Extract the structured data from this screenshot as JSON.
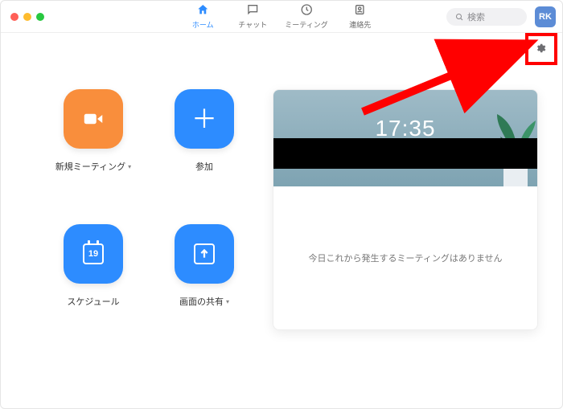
{
  "header": {
    "tabs": [
      {
        "id": "home",
        "label": "ホーム",
        "icon": "home-icon",
        "active": true
      },
      {
        "id": "chat",
        "label": "チャット",
        "icon": "chat-icon",
        "active": false
      },
      {
        "id": "meetings",
        "label": "ミーティング",
        "icon": "clock-icon",
        "active": false
      },
      {
        "id": "contacts",
        "label": "連絡先",
        "icon": "contact-icon",
        "active": false
      }
    ],
    "search_placeholder": "検索",
    "avatar_initials": "RK"
  },
  "actions": {
    "new_meeting": {
      "label": "新規ミーティング",
      "has_dropdown": true,
      "color": "orange",
      "icon": "video-icon"
    },
    "join": {
      "label": "参加",
      "has_dropdown": false,
      "color": "blue",
      "icon": "plus-icon"
    },
    "schedule": {
      "label": "スケジュール",
      "has_dropdown": false,
      "color": "blue",
      "icon": "calendar-icon",
      "calendar_day": "19"
    },
    "share": {
      "label": "画面の共有",
      "has_dropdown": true,
      "color": "blue",
      "icon": "share-up-icon"
    }
  },
  "panel": {
    "time": "17:35",
    "empty_text": "今日これから発生するミーティングはありません"
  },
  "annotation": {
    "target": "settings-gear"
  }
}
